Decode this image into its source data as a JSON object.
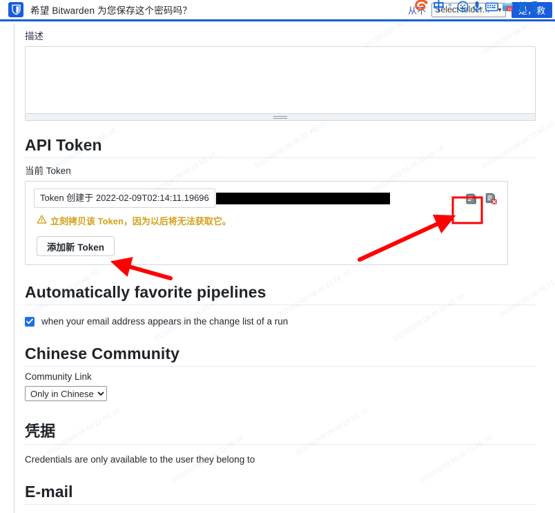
{
  "notification_bar": {
    "app": "Bitwarden",
    "title": "希望 Bitwarden 为您保存这个密码吗？",
    "never_link": "从不",
    "folder_select_value": "Select folder...",
    "folder_caret": "▼",
    "save_button": "是，救",
    "logo_icon": "bitwarden-shield-icon"
  },
  "ime_toolbar": {
    "brand_icon": "sogou-logo-icon",
    "mode_label": "中",
    "punctuation_label": "°,",
    "icons": [
      "emoji-icon",
      "microphone-icon",
      "keyboard-icon",
      "calendar-icon",
      "skin-shirt-icon",
      "toolbox-icon"
    ]
  },
  "description": {
    "label": "描述",
    "value": "",
    "placeholder": ""
  },
  "api_token": {
    "heading": "API Token",
    "current_label": "当前 Token",
    "token_created_text": "Token 创建于 2022-02-09T02:14:11.19696",
    "token_value_redacted": "",
    "copy_icon": "copy-icon",
    "revoke_icon": "revoke-token-icon",
    "warning": "立刻拷贝该 Token，因为以后将无法获取它。",
    "warning_icon": "warning-triangle-icon",
    "add_token_button": "添加新 Token"
  },
  "favorite_pipelines": {
    "heading": "Automatically favorite pipelines",
    "checkbox_label": "when your email address appears in the change list of a run",
    "checkbox_checked": true,
    "check_icon": "checkmark-icon"
  },
  "chinese_community": {
    "heading": "Chinese Community",
    "link_label": "Community Link",
    "selected_option": "Only in Chinese",
    "options": [
      "Only in Chinese"
    ]
  },
  "credentials": {
    "heading": "凭据",
    "description": "Credentials are only available to the user they belong to"
  },
  "email": {
    "heading": "E-mail"
  },
  "annotations": {
    "highlight_box_color": "#ff0000",
    "arrow_color": "#ff0000",
    "arrow_1_target": "copy-icon",
    "arrow_2_target": "add-token-button"
  },
  "watermark": {
    "text": "2022/02/09 08:46:23 AE-16"
  },
  "colors": {
    "accent_blue": "#175ddc",
    "warning_amber": "#d4a017",
    "checkbox_blue": "#1f6feb",
    "annotation_red": "#ff0000"
  }
}
